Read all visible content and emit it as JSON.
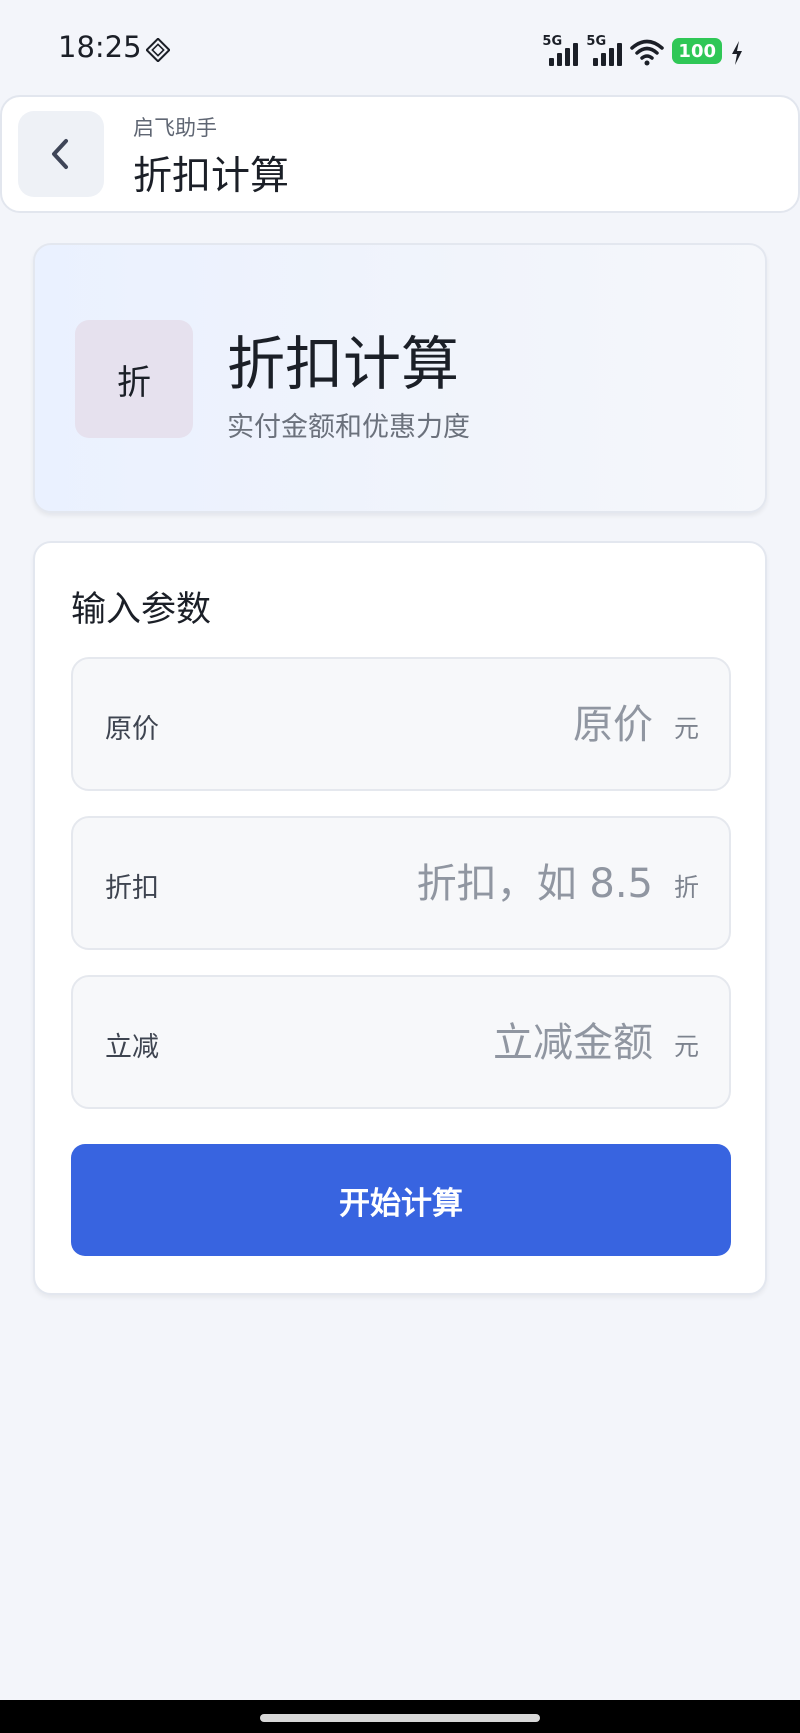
{
  "status_bar": {
    "time": "18:25",
    "signal1_label": "5G",
    "signal2_label": "5G",
    "battery_level": "100",
    "icons": [
      "nfc-icon",
      "signal-icon",
      "signal-icon",
      "wifi-icon",
      "battery-icon",
      "charging-icon"
    ]
  },
  "header": {
    "app_name": "启飞助手",
    "title": "折扣计算",
    "back_icon": "chevron-left-icon"
  },
  "hero": {
    "icon_text": "折",
    "title": "折扣计算",
    "subtitle": "实付金额和优惠力度"
  },
  "form": {
    "title": "输入参数",
    "fields": [
      {
        "label": "原价",
        "placeholder": "原价",
        "unit": "元"
      },
      {
        "label": "折扣",
        "placeholder": "折扣，如 8.5",
        "unit": "折"
      },
      {
        "label": "立减",
        "placeholder": "立减金额",
        "unit": "元"
      }
    ],
    "submit_label": "开始计算"
  },
  "colors": {
    "accent": "#3864e0",
    "background": "#f3f5fa",
    "battery": "#2fc756"
  }
}
